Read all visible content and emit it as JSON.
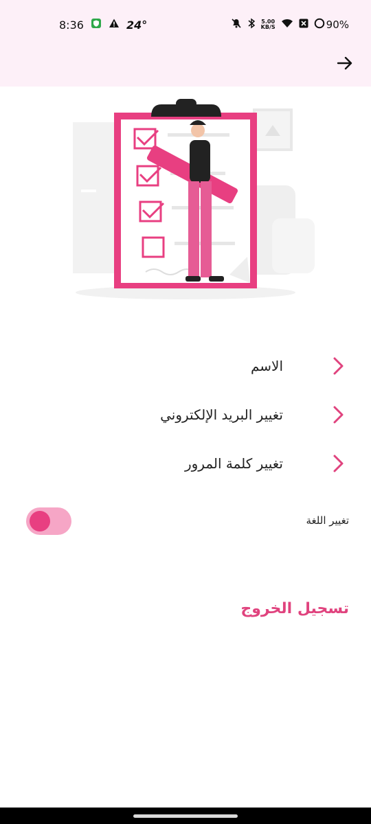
{
  "status_bar": {
    "time": "8:36",
    "temperature": "24°",
    "network_speed": "5.00",
    "network_unit": "KB/S",
    "battery": "90%",
    "icons": [
      "shield-icon",
      "warning-icon",
      "mute-icon",
      "bluetooth-icon",
      "wifi-icon",
      "close-box-icon",
      "battery-ring-icon"
    ]
  },
  "app_bar": {
    "back_icon": "arrow-right-icon"
  },
  "menu": {
    "items": [
      {
        "label": "الاسم",
        "icon": "chevron-right-icon"
      },
      {
        "label": "تغيير البريد الإلكتروني",
        "icon": "chevron-right-icon"
      },
      {
        "label": "تغيير كلمة المرور",
        "icon": "chevron-right-icon"
      }
    ]
  },
  "language": {
    "label": "تغيير اللغة",
    "toggle_on": false
  },
  "logout": {
    "label": "تسجيل الخروج"
  },
  "colors": {
    "accent": "#e83f81",
    "accent_light": "#f6a6c6",
    "header_bg": "#fdf0f8",
    "logout_text": "#e0437e"
  }
}
